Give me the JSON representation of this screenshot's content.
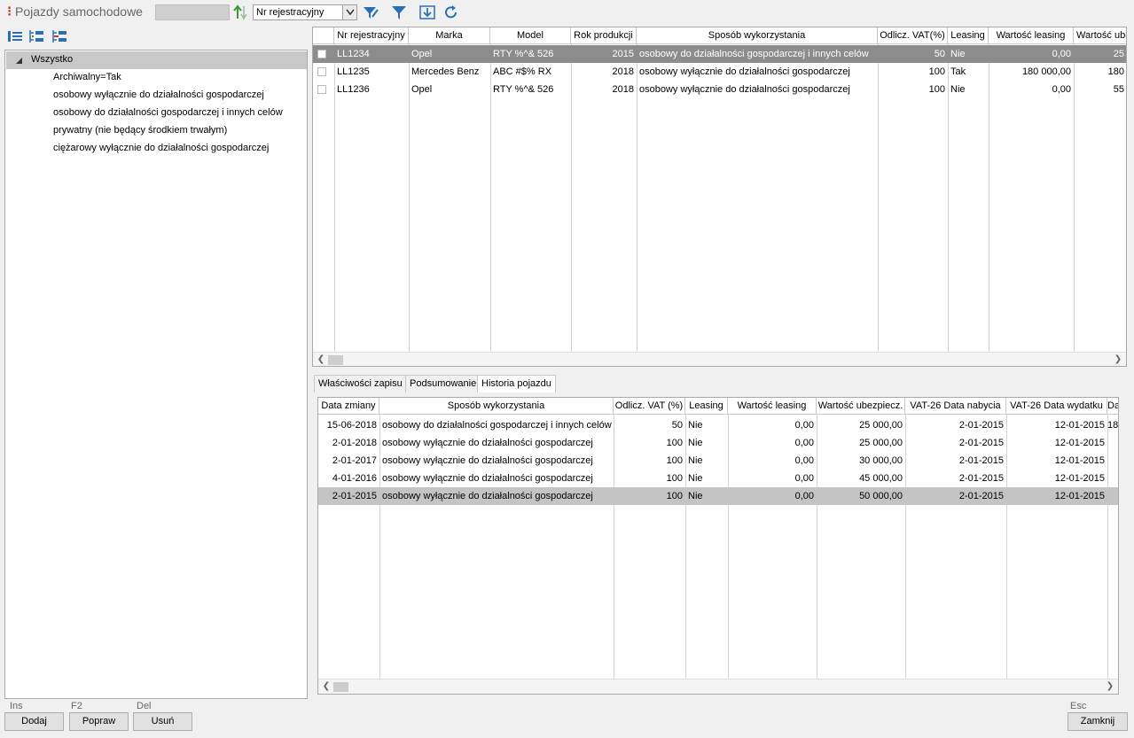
{
  "window": {
    "title": "Pojazdy samochodowe"
  },
  "toolbar": {
    "search_value": "",
    "sort_field": "Nr rejestracyjny"
  },
  "tree": {
    "root": "Wszystko",
    "items": [
      "Archiwalny=Tak",
      "osobowy wyłącznie do działalności gospodarczej",
      "osobowy do działalności gospodarczej i innych celów",
      "prywatny (nie będący środkiem trwałym)",
      "ciężarowy wyłącznie do działalności gospodarczej"
    ]
  },
  "vehicles": {
    "headers": [
      "Nr rejestracyjny",
      "Marka",
      "Model",
      "Rok produkcji",
      "Sposób wykorzystania",
      "Odlicz. VAT(%)",
      "Leasing",
      "Wartość leasing",
      "Wartość ube"
    ],
    "rows": [
      [
        "LL1234",
        "Opel",
        "RTY %^& 526",
        "2015",
        "osobowy do działalności gospodarczej i innych celów",
        "50",
        "Nie",
        "0,00",
        "25"
      ],
      [
        "LL1235",
        "Mercedes Benz",
        "ABC #$% RX",
        "2018",
        "osobowy wyłącznie do działalności gospodarczej",
        "100",
        "Tak",
        "180 000,00",
        "180"
      ],
      [
        "LL1236",
        "Opel",
        "RTY %^& 526",
        "2018",
        "osobowy wyłącznie do działalności gospodarczej",
        "100",
        "Nie",
        "0,00",
        "55"
      ]
    ]
  },
  "tabs": [
    "Właściwości zapisu",
    "Podsumowanie",
    "Historia pojazdu"
  ],
  "history": {
    "headers": [
      "Data zmiany",
      "Sposób wykorzystania",
      "Odlicz. VAT (%)",
      "Leasing",
      "Wartość leasing",
      "Wartość ubezpiecz.",
      "VAT-26 Data nabycia",
      "VAT-26 Data wydatku",
      "Da"
    ],
    "rows": [
      [
        "15-06-2018",
        "osobowy do działalności gospodarczej i innych celów",
        "50",
        "Nie",
        "0,00",
        "25 000,00",
        "2-01-2015",
        "12-01-2015",
        "18"
      ],
      [
        "2-01-2018",
        "osobowy wyłącznie do działalności gospodarczej",
        "100",
        "Nie",
        "0,00",
        "25 000,00",
        "2-01-2015",
        "12-01-2015",
        ""
      ],
      [
        "2-01-2017",
        "osobowy wyłącznie do działalności gospodarczej",
        "100",
        "Nie",
        "0,00",
        "30 000,00",
        "2-01-2015",
        "12-01-2015",
        ""
      ],
      [
        "4-01-2016",
        "osobowy wyłącznie do działalności gospodarczej",
        "100",
        "Nie",
        "0,00",
        "45 000,00",
        "2-01-2015",
        "12-01-2015",
        ""
      ],
      [
        "2-01-2015",
        "osobowy wyłącznie do działalności gospodarczej",
        "100",
        "Nie",
        "0,00",
        "50 000,00",
        "2-01-2015",
        "12-01-2015",
        ""
      ]
    ]
  },
  "buttons": {
    "add": {
      "key": "Ins",
      "label": "Dodaj"
    },
    "edit": {
      "key": "F2",
      "label": "Popraw"
    },
    "delete": {
      "key": "Del",
      "label": "Usuń"
    },
    "close": {
      "key": "Esc",
      "label": "Zamknij"
    }
  },
  "colors": {
    "selected_dark": "#8c8c8c",
    "selected_light": "#c4c4c4",
    "accent_blue": "#2a6fb5",
    "accent_green": "#3a9a3a"
  }
}
